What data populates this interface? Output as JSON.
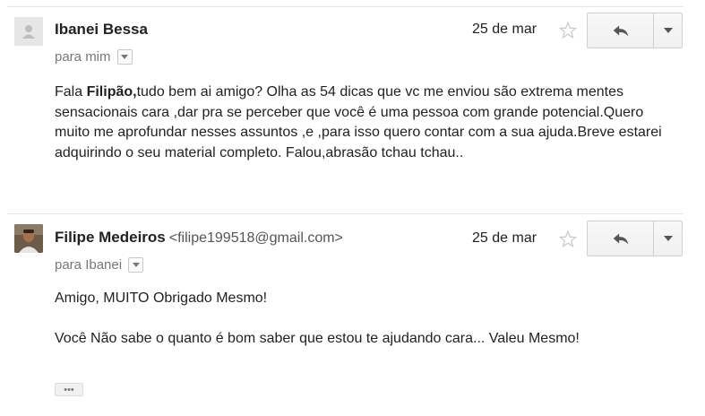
{
  "messages": [
    {
      "sender": "Ibanei Bessa",
      "email": "",
      "date": "25 de mar",
      "to": "para mim",
      "body": {
        "greeting": "Fala ",
        "name_bold": "Filipão,",
        "text": "tudo bem ai amigo? Olha as 54 dicas que vc me enviou são extrema mentes  sensacionais cara ,dar pra se perceber que você é uma pessoa com grande potencial.Quero muito me aprofundar nesses assuntos ,e ,para isso quero contar com a sua ajuda.Breve estarei adquirindo o seu material completo. Falou,abrasão tchau tchau.."
      },
      "avatar": "default-avatar-icon",
      "starred": false
    },
    {
      "sender": "Filipe Medeiros",
      "email": "<filipe199518@gmail.com>",
      "date": "25 de mar",
      "to": "para Ibanei",
      "body": {
        "line1": "Amigo, MUITO Obrigado Mesmo!",
        "line2": "Você Não sabe o quanto é bom saber que estou te ajudando cara... Valeu Mesmo!"
      },
      "avatar": "profile-photo",
      "starred": false,
      "show_trimmed": "•••"
    }
  ],
  "icons": {
    "reply": "reply-arrow-icon",
    "more": "chevron-down-icon",
    "star": "star-outline-icon"
  }
}
